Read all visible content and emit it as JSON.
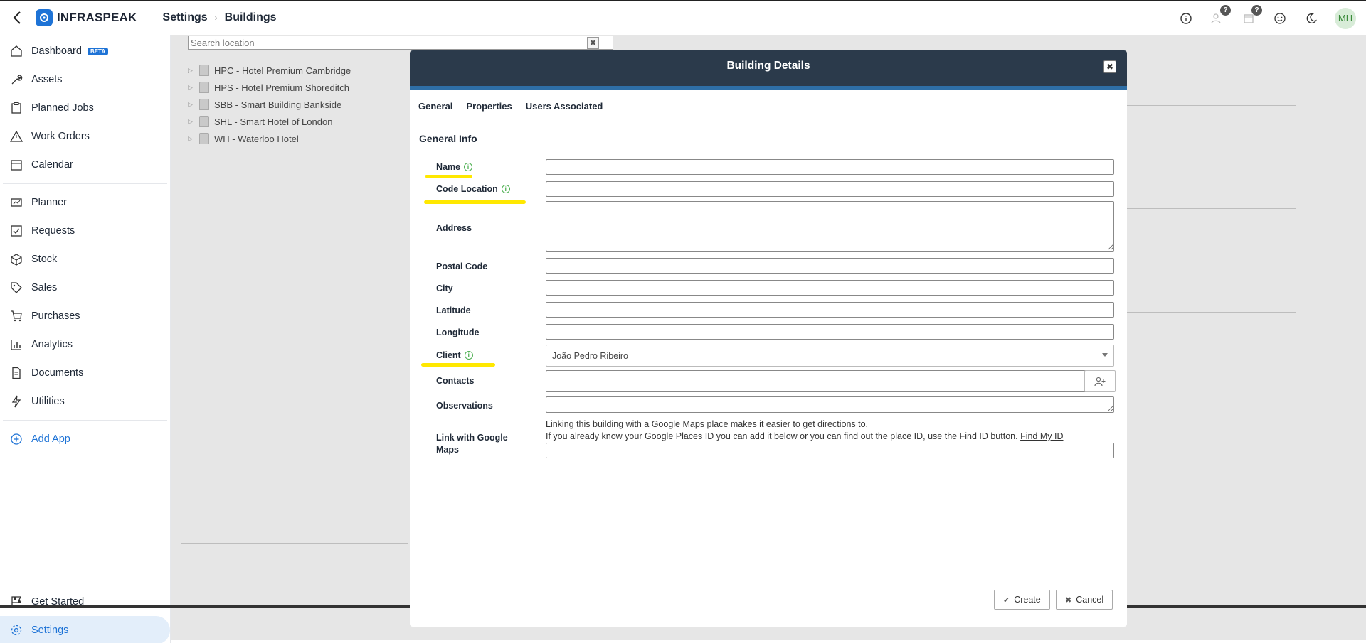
{
  "app": {
    "name": "INFRASPEAK",
    "avatar_initials": "MH"
  },
  "breadcrumb": {
    "first": "Settings",
    "second": "Buildings"
  },
  "topbar_icons": [
    "info-icon",
    "help-users-icon",
    "help-calendar-icon",
    "smiley-icon",
    "moon-icon"
  ],
  "topbar_badges": {
    "help_users": "?",
    "help_calendar": "?"
  },
  "sidebar": {
    "items": [
      {
        "label": "Dashboard",
        "badge": "BETA",
        "icon": "home-icon"
      },
      {
        "label": "Assets",
        "icon": "wrench-icon"
      },
      {
        "label": "Planned Jobs",
        "icon": "clipboard-icon"
      },
      {
        "label": "Work Orders",
        "icon": "warning-icon"
      },
      {
        "label": "Calendar",
        "icon": "calendar-icon"
      },
      {
        "label": "Planner",
        "icon": "planner-icon"
      },
      {
        "label": "Requests",
        "icon": "requests-icon"
      },
      {
        "label": "Stock",
        "icon": "box-icon"
      },
      {
        "label": "Sales",
        "icon": "tag-icon"
      },
      {
        "label": "Purchases",
        "icon": "cart-icon"
      },
      {
        "label": "Analytics",
        "icon": "chart-icon"
      },
      {
        "label": "Documents",
        "icon": "document-icon"
      },
      {
        "label": "Utilities",
        "icon": "bolt-icon"
      }
    ],
    "add_app": "Add App",
    "get_started": "Get Started",
    "settings": "Settings"
  },
  "search": {
    "placeholder": "Search location",
    "clear": "✖"
  },
  "tree": [
    "HPC - Hotel Premium Cambridge",
    "HPS - Hotel Premium Shoreditch",
    "SBB - Smart Building Bankside",
    "SHL - Smart Hotel of London",
    "WH - Waterloo Hotel"
  ],
  "modal": {
    "title": "Building Details",
    "close": "✖",
    "tabs": [
      "General",
      "Properties",
      "Users Associated"
    ],
    "section": "General Info",
    "fields": {
      "name": "Name",
      "code_location": "Code Location",
      "address": "Address",
      "postal_code": "Postal Code",
      "city": "City",
      "latitude": "Latitude",
      "longitude": "Longitude",
      "client": "Client",
      "contacts": "Contacts",
      "observations": "Observations",
      "gmaps": "Link with Google Maps"
    },
    "client_value": "João Pedro Ribeiro",
    "gmaps_line1": "Linking this building with a Google Maps place makes it easier to get directions to.",
    "gmaps_line2": "If you already know your Google Places ID you can add it below or you can find out the place ID, use the Find ID button.",
    "find_id": "Find My ID",
    "create": "Create",
    "cancel": "Cancel",
    "highlight_color": "#ffe800"
  }
}
